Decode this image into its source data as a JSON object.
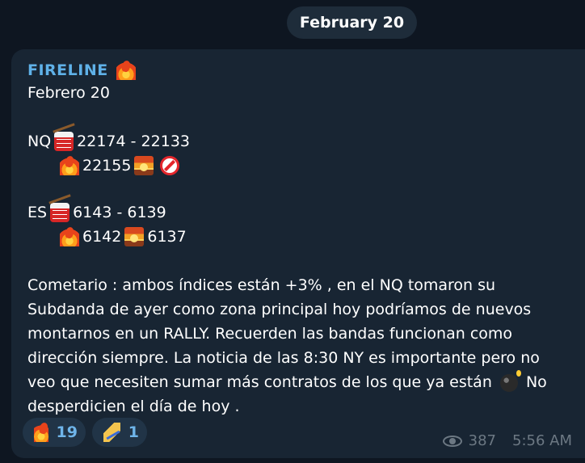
{
  "date_pill": "February 20",
  "message": {
    "sender": "FIRELINE",
    "date_line": "Febrero 20",
    "nq_line1_label": "NQ",
    "nq_line1_value": "22174 - 22133",
    "nq_line2_value": "22155",
    "es_line1_label": "ES",
    "es_line1_value": "6143 - 6139",
    "es_line2_value_a": "6142",
    "es_line2_value_b": "6137",
    "body_text": "Cometario : ambos índices están +3% , en el NQ tomaron su Subdanda de ayer como zona principal hoy podríamos de nuevos montarnos en un RALLY.  Recuerden las bandas funcionan como dirección siempre. La noticia de las 8:30 NY es importante pero no veo que necesiten sumar más contratos de los que ya están",
    "body_tail": "No desperdicien el día de hoy ."
  },
  "reactions": [
    {
      "icon": "fire-icon",
      "count": "19"
    },
    {
      "icon": "writing-hand-icon",
      "count": "1"
    }
  ],
  "footer": {
    "views": "387",
    "time": "5:56 AM"
  }
}
